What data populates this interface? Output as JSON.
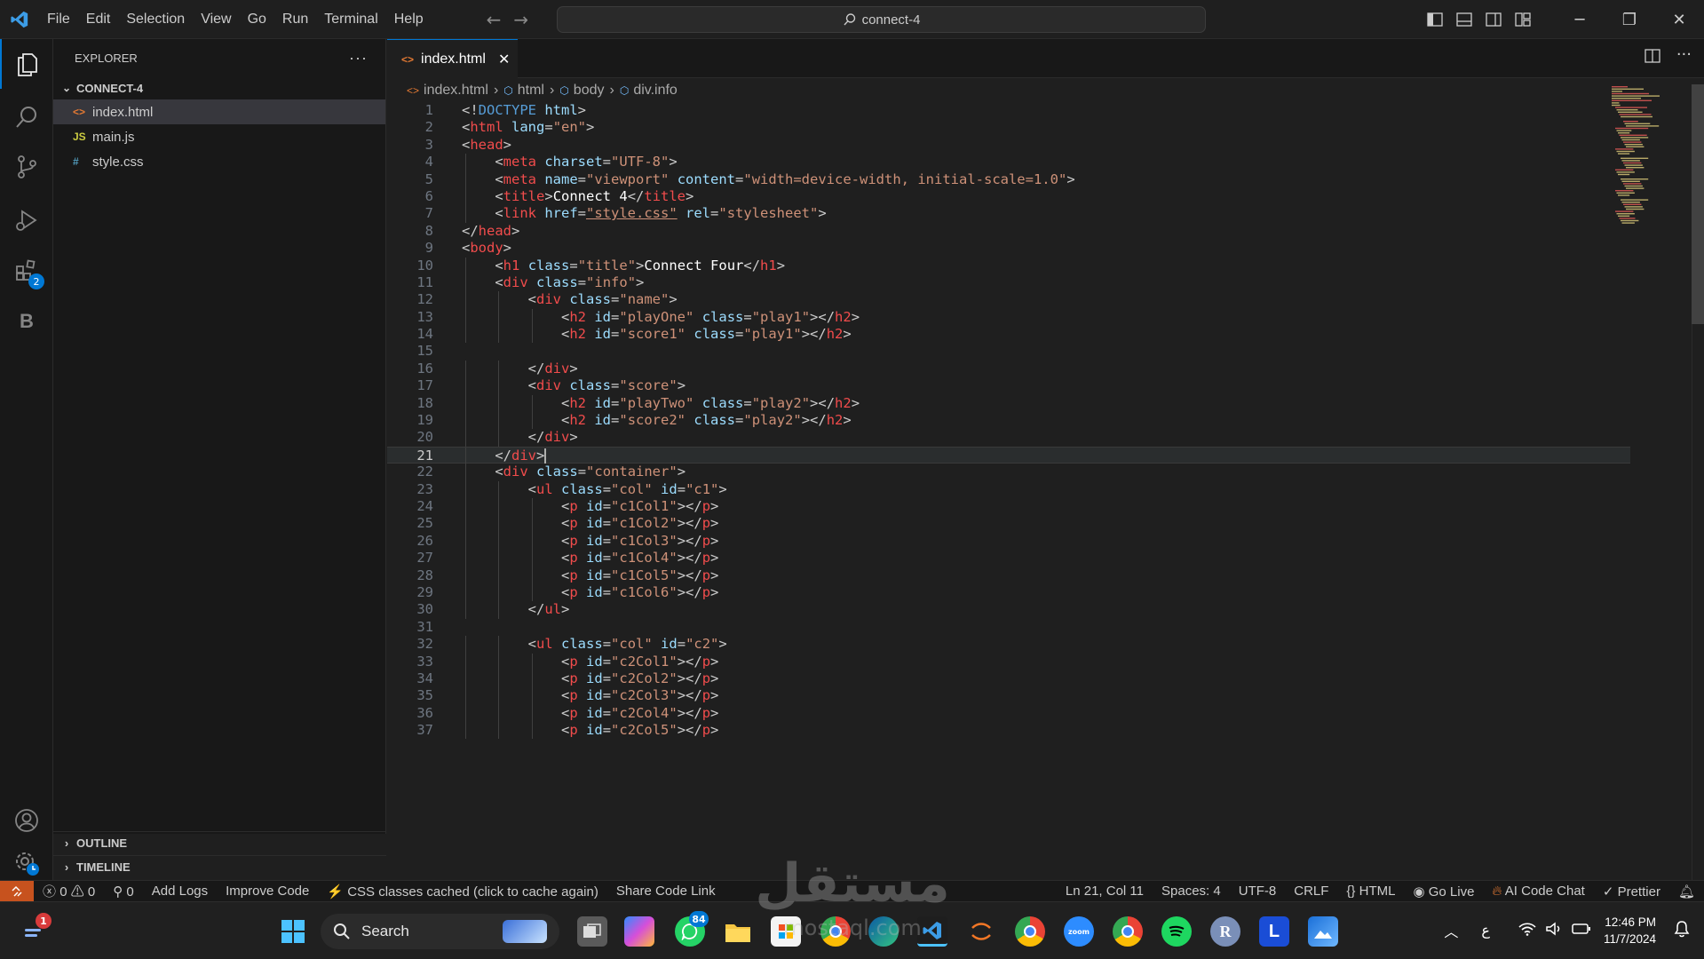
{
  "menu": [
    "File",
    "Edit",
    "Selection",
    "View",
    "Go",
    "Run",
    "Terminal",
    "Help"
  ],
  "command_center": "connect-4",
  "explorer": {
    "title": "EXPLORER",
    "folder": "CONNECT-4",
    "files": [
      {
        "name": "index.html",
        "icon": "<>",
        "icon_color": "#e37933"
      },
      {
        "name": "main.js",
        "icon": "JS",
        "icon_color": "#cbcb41"
      },
      {
        "name": "style.css",
        "icon": "#",
        "icon_color": "#519aba"
      }
    ],
    "outline": "OUTLINE",
    "timeline": "TIMELINE"
  },
  "activity": {
    "extensions_badge": "2"
  },
  "tab": {
    "label": "index.html",
    "close": "✕"
  },
  "breadcrumb": [
    "index.html",
    "html",
    "body",
    "div.info"
  ],
  "code_lines": [
    [
      [
        "pn",
        "<!"
      ],
      [
        "dt",
        "DOCTYPE"
      ],
      [
        "pn",
        " "
      ],
      [
        "at",
        "html"
      ],
      [
        "pn",
        ">"
      ]
    ],
    [
      [
        "pn",
        "<"
      ],
      [
        "tg",
        "html"
      ],
      [
        "pn",
        " "
      ],
      [
        "at",
        "lang"
      ],
      [
        "pn",
        "="
      ],
      [
        "st",
        "\"en\""
      ],
      [
        "pn",
        ">"
      ]
    ],
    [
      [
        "pn",
        "<"
      ],
      [
        "tg",
        "head"
      ],
      [
        "pn",
        ">"
      ]
    ],
    [
      [
        "pn",
        "    <"
      ],
      [
        "tg",
        "meta"
      ],
      [
        "pn",
        " "
      ],
      [
        "at",
        "charset"
      ],
      [
        "pn",
        "="
      ],
      [
        "st",
        "\"UTF-8\""
      ],
      [
        "pn",
        ">"
      ]
    ],
    [
      [
        "pn",
        "    <"
      ],
      [
        "tg",
        "meta"
      ],
      [
        "pn",
        " "
      ],
      [
        "at",
        "name"
      ],
      [
        "pn",
        "="
      ],
      [
        "st",
        "\"viewport\""
      ],
      [
        "pn",
        " "
      ],
      [
        "at",
        "content"
      ],
      [
        "pn",
        "="
      ],
      [
        "st",
        "\"width=device-width, initial-scale=1.0\""
      ],
      [
        "pn",
        ">"
      ]
    ],
    [
      [
        "pn",
        "    <"
      ],
      [
        "tg",
        "title"
      ],
      [
        "pn",
        ">"
      ],
      [
        "tx",
        "Connect 4"
      ],
      [
        "pn",
        "</"
      ],
      [
        "tg",
        "title"
      ],
      [
        "pn",
        ">"
      ]
    ],
    [
      [
        "pn",
        "    <"
      ],
      [
        "tg",
        "link"
      ],
      [
        "pn",
        " "
      ],
      [
        "at",
        "href"
      ],
      [
        "pn",
        "="
      ],
      [
        "st",
        "\"style.css\""
      ],
      [
        "pn",
        " "
      ],
      [
        "at",
        "rel"
      ],
      [
        "pn",
        "="
      ],
      [
        "st",
        "\"stylesheet\""
      ],
      [
        "pn",
        ">"
      ]
    ],
    [
      [
        "pn",
        "</"
      ],
      [
        "tg",
        "head"
      ],
      [
        "pn",
        ">"
      ]
    ],
    [
      [
        "pn",
        "<"
      ],
      [
        "tg",
        "body"
      ],
      [
        "pn",
        ">"
      ]
    ],
    [
      [
        "pn",
        "    <"
      ],
      [
        "tg",
        "h1"
      ],
      [
        "pn",
        " "
      ],
      [
        "at",
        "class"
      ],
      [
        "pn",
        "="
      ],
      [
        "st",
        "\"title\""
      ],
      [
        "pn",
        ">"
      ],
      [
        "tx",
        "Connect Four"
      ],
      [
        "pn",
        "</"
      ],
      [
        "tg",
        "h1"
      ],
      [
        "pn",
        ">"
      ]
    ],
    [
      [
        "pn",
        "    <"
      ],
      [
        "tg",
        "div"
      ],
      [
        "pn",
        " "
      ],
      [
        "at",
        "class"
      ],
      [
        "pn",
        "="
      ],
      [
        "st",
        "\"info\""
      ],
      [
        "pn",
        ">"
      ]
    ],
    [
      [
        "pn",
        "        <"
      ],
      [
        "tg",
        "div"
      ],
      [
        "pn",
        " "
      ],
      [
        "at",
        "class"
      ],
      [
        "pn",
        "="
      ],
      [
        "st",
        "\"name\""
      ],
      [
        "pn",
        ">"
      ]
    ],
    [
      [
        "pn",
        "            <"
      ],
      [
        "tg",
        "h2"
      ],
      [
        "pn",
        " "
      ],
      [
        "at",
        "id"
      ],
      [
        "pn",
        "="
      ],
      [
        "st",
        "\"playOne\""
      ],
      [
        "pn",
        " "
      ],
      [
        "at",
        "class"
      ],
      [
        "pn",
        "="
      ],
      [
        "st",
        "\"play1\""
      ],
      [
        "pn",
        "></"
      ],
      [
        "tg",
        "h2"
      ],
      [
        "pn",
        ">"
      ]
    ],
    [
      [
        "pn",
        "            <"
      ],
      [
        "tg",
        "h2"
      ],
      [
        "pn",
        " "
      ],
      [
        "at",
        "id"
      ],
      [
        "pn",
        "="
      ],
      [
        "st",
        "\"score1\""
      ],
      [
        "pn",
        " "
      ],
      [
        "at",
        "class"
      ],
      [
        "pn",
        "="
      ],
      [
        "st",
        "\"play1\""
      ],
      [
        "pn",
        "></"
      ],
      [
        "tg",
        "h2"
      ],
      [
        "pn",
        ">"
      ]
    ],
    [
      [
        "pn",
        ""
      ]
    ],
    [
      [
        "pn",
        "        </"
      ],
      [
        "tg",
        "div"
      ],
      [
        "pn",
        ">"
      ]
    ],
    [
      [
        "pn",
        "        <"
      ],
      [
        "tg",
        "div"
      ],
      [
        "pn",
        " "
      ],
      [
        "at",
        "class"
      ],
      [
        "pn",
        "="
      ],
      [
        "st",
        "\"score\""
      ],
      [
        "pn",
        ">"
      ]
    ],
    [
      [
        "pn",
        "            <"
      ],
      [
        "tg",
        "h2"
      ],
      [
        "pn",
        " "
      ],
      [
        "at",
        "id"
      ],
      [
        "pn",
        "="
      ],
      [
        "st",
        "\"playTwo\""
      ],
      [
        "pn",
        " "
      ],
      [
        "at",
        "class"
      ],
      [
        "pn",
        "="
      ],
      [
        "st",
        "\"play2\""
      ],
      [
        "pn",
        "></"
      ],
      [
        "tg",
        "h2"
      ],
      [
        "pn",
        ">"
      ]
    ],
    [
      [
        "pn",
        "            <"
      ],
      [
        "tg",
        "h2"
      ],
      [
        "pn",
        " "
      ],
      [
        "at",
        "id"
      ],
      [
        "pn",
        "="
      ],
      [
        "st",
        "\"score2\""
      ],
      [
        "pn",
        " "
      ],
      [
        "at",
        "class"
      ],
      [
        "pn",
        "="
      ],
      [
        "st",
        "\"play2\""
      ],
      [
        "pn",
        "></"
      ],
      [
        "tg",
        "h2"
      ],
      [
        "pn",
        ">"
      ]
    ],
    [
      [
        "pn",
        "        </"
      ],
      [
        "tg",
        "div"
      ],
      [
        "pn",
        ">"
      ]
    ],
    [
      [
        "pn",
        "    </"
      ],
      [
        "tg",
        "div"
      ],
      [
        "pn",
        ">"
      ]
    ],
    [
      [
        "pn",
        "    <"
      ],
      [
        "tg",
        "div"
      ],
      [
        "pn",
        " "
      ],
      [
        "at",
        "class"
      ],
      [
        "pn",
        "="
      ],
      [
        "st",
        "\"container\""
      ],
      [
        "pn",
        ">"
      ]
    ],
    [
      [
        "pn",
        "        <"
      ],
      [
        "tg",
        "ul"
      ],
      [
        "pn",
        " "
      ],
      [
        "at",
        "class"
      ],
      [
        "pn",
        "="
      ],
      [
        "st",
        "\"col\""
      ],
      [
        "pn",
        " "
      ],
      [
        "at",
        "id"
      ],
      [
        "pn",
        "="
      ],
      [
        "st",
        "\"c1\""
      ],
      [
        "pn",
        ">"
      ]
    ],
    [
      [
        "pn",
        "            <"
      ],
      [
        "tg",
        "p"
      ],
      [
        "pn",
        " "
      ],
      [
        "at",
        "id"
      ],
      [
        "pn",
        "="
      ],
      [
        "st",
        "\"c1Col1\""
      ],
      [
        "pn",
        "></"
      ],
      [
        "tg",
        "p"
      ],
      [
        "pn",
        ">"
      ]
    ],
    [
      [
        "pn",
        "            <"
      ],
      [
        "tg",
        "p"
      ],
      [
        "pn",
        " "
      ],
      [
        "at",
        "id"
      ],
      [
        "pn",
        "="
      ],
      [
        "st",
        "\"c1Col2\""
      ],
      [
        "pn",
        "></"
      ],
      [
        "tg",
        "p"
      ],
      [
        "pn",
        ">"
      ]
    ],
    [
      [
        "pn",
        "            <"
      ],
      [
        "tg",
        "p"
      ],
      [
        "pn",
        " "
      ],
      [
        "at",
        "id"
      ],
      [
        "pn",
        "="
      ],
      [
        "st",
        "\"c1Col3\""
      ],
      [
        "pn",
        "></"
      ],
      [
        "tg",
        "p"
      ],
      [
        "pn",
        ">"
      ]
    ],
    [
      [
        "pn",
        "            <"
      ],
      [
        "tg",
        "p"
      ],
      [
        "pn",
        " "
      ],
      [
        "at",
        "id"
      ],
      [
        "pn",
        "="
      ],
      [
        "st",
        "\"c1Col4\""
      ],
      [
        "pn",
        "></"
      ],
      [
        "tg",
        "p"
      ],
      [
        "pn",
        ">"
      ]
    ],
    [
      [
        "pn",
        "            <"
      ],
      [
        "tg",
        "p"
      ],
      [
        "pn",
        " "
      ],
      [
        "at",
        "id"
      ],
      [
        "pn",
        "="
      ],
      [
        "st",
        "\"c1Col5\""
      ],
      [
        "pn",
        "></"
      ],
      [
        "tg",
        "p"
      ],
      [
        "pn",
        ">"
      ]
    ],
    [
      [
        "pn",
        "            <"
      ],
      [
        "tg",
        "p"
      ],
      [
        "pn",
        " "
      ],
      [
        "at",
        "id"
      ],
      [
        "pn",
        "="
      ],
      [
        "st",
        "\"c1Col6\""
      ],
      [
        "pn",
        "></"
      ],
      [
        "tg",
        "p"
      ],
      [
        "pn",
        ">"
      ]
    ],
    [
      [
        "pn",
        "        </"
      ],
      [
        "tg",
        "ul"
      ],
      [
        "pn",
        ">"
      ]
    ],
    [
      [
        "pn",
        ""
      ]
    ],
    [
      [
        "pn",
        "        <"
      ],
      [
        "tg",
        "ul"
      ],
      [
        "pn",
        " "
      ],
      [
        "at",
        "class"
      ],
      [
        "pn",
        "="
      ],
      [
        "st",
        "\"col\""
      ],
      [
        "pn",
        " "
      ],
      [
        "at",
        "id"
      ],
      [
        "pn",
        "="
      ],
      [
        "st",
        "\"c2\""
      ],
      [
        "pn",
        ">"
      ]
    ],
    [
      [
        "pn",
        "            <"
      ],
      [
        "tg",
        "p"
      ],
      [
        "pn",
        " "
      ],
      [
        "at",
        "id"
      ],
      [
        "pn",
        "="
      ],
      [
        "st",
        "\"c2Col1\""
      ],
      [
        "pn",
        "></"
      ],
      [
        "tg",
        "p"
      ],
      [
        "pn",
        ">"
      ]
    ],
    [
      [
        "pn",
        "            <"
      ],
      [
        "tg",
        "p"
      ],
      [
        "pn",
        " "
      ],
      [
        "at",
        "id"
      ],
      [
        "pn",
        "="
      ],
      [
        "st",
        "\"c2Col2\""
      ],
      [
        "pn",
        "></"
      ],
      [
        "tg",
        "p"
      ],
      [
        "pn",
        ">"
      ]
    ],
    [
      [
        "pn",
        "            <"
      ],
      [
        "tg",
        "p"
      ],
      [
        "pn",
        " "
      ],
      [
        "at",
        "id"
      ],
      [
        "pn",
        "="
      ],
      [
        "st",
        "\"c2Col3\""
      ],
      [
        "pn",
        "></"
      ],
      [
        "tg",
        "p"
      ],
      [
        "pn",
        ">"
      ]
    ],
    [
      [
        "pn",
        "            <"
      ],
      [
        "tg",
        "p"
      ],
      [
        "pn",
        " "
      ],
      [
        "at",
        "id"
      ],
      [
        "pn",
        "="
      ],
      [
        "st",
        "\"c2Col4\""
      ],
      [
        "pn",
        "></"
      ],
      [
        "tg",
        "p"
      ],
      [
        "pn",
        ">"
      ]
    ],
    [
      [
        "pn",
        "            <"
      ],
      [
        "tg",
        "p"
      ],
      [
        "pn",
        " "
      ],
      [
        "at",
        "id"
      ],
      [
        "pn",
        "="
      ],
      [
        "st",
        "\"c2Col5\""
      ],
      [
        "pn",
        "></"
      ],
      [
        "tg",
        "p"
      ],
      [
        "pn",
        ">"
      ]
    ]
  ],
  "current_line": 21,
  "status": {
    "errors": "0",
    "warnings": "0",
    "ports": "0",
    "add_logs": "Add Logs",
    "improve_code": "Improve Code",
    "css_cache": "CSS classes cached (click to cache again)",
    "share_code": "Share Code Link",
    "position": "Ln 21, Col 11",
    "spaces": "Spaces: 4",
    "encoding": "UTF-8",
    "eol": "CRLF",
    "language": "HTML",
    "go_live": "Go Live",
    "ai_chat": "AI Code Chat",
    "prettier": "Prettier"
  },
  "taskbar": {
    "search_label": "Search",
    "whatsapp_badge": "84",
    "notification_badge": "1",
    "time": "12:46 PM",
    "date": "11/7/2024",
    "lang": "ع"
  },
  "watermark": {
    "text": "مستقل",
    "sub": "mostaql.com"
  }
}
